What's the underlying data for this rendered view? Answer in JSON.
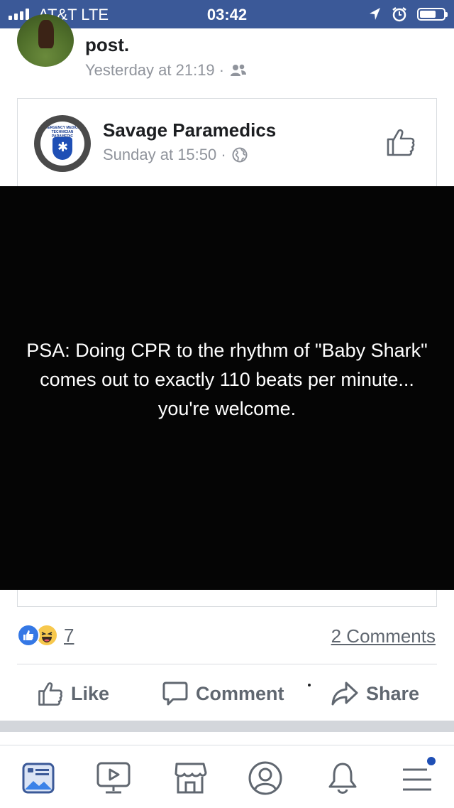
{
  "status_bar": {
    "carrier": "AT&T  LTE",
    "time": "03:42"
  },
  "prev_post": {
    "text": "post.",
    "timestamp": "Yesterday at 21:19 ·",
    "audience_icon": "friends-icon"
  },
  "shared_post": {
    "page_name": "Savage Paramedics",
    "avatar_text": "EMERGENCY MEDICAL TECHNICIAN PARAMEDIC",
    "timestamp": "Sunday at 15:50 ·",
    "audience_icon": "globe-icon",
    "image_caption": "PSA: Doing CPR to the rhythm of \"Baby Shark\" comes out to exactly 110 beats per minute... you're welcome."
  },
  "engagement": {
    "reaction_count": "7",
    "comments": "2 Comments"
  },
  "actions": {
    "like": "Like",
    "comment": "Comment",
    "share": "Share"
  },
  "tab_bar": {
    "tabs": [
      "news-feed-icon",
      "watch-icon",
      "marketplace-icon",
      "profile-icon",
      "notifications-icon",
      "menu-icon"
    ],
    "accent": "#3b5998"
  }
}
